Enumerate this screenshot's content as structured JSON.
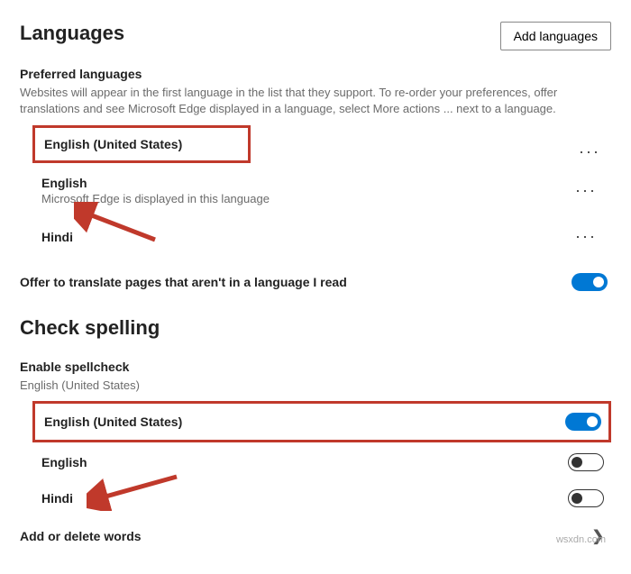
{
  "section_languages_title": "Languages",
  "add_languages_button": "Add languages",
  "preferred_heading": "Preferred languages",
  "preferred_desc": "Websites will appear in the first language in the list that they support. To re-order your preferences, offer translations and see Microsoft Edge displayed in a language, select More actions ... next to a language.",
  "langs": {
    "en_us": {
      "name": "English (United States)"
    },
    "en": {
      "name": "English",
      "sub": "Microsoft Edge is displayed in this language"
    },
    "hi": {
      "name": "Hindi"
    }
  },
  "offer_translate_label": "Offer to translate pages that aren't in a language I read",
  "section_spelling_title": "Check spelling",
  "enable_spellcheck_heading": "Enable spellcheck",
  "enable_spellcheck_sub": "English (United States)",
  "spell": {
    "en_us": "English (United States)",
    "en": "English",
    "hi": "Hindi"
  },
  "add_delete_words": "Add or delete words",
  "watermark": "wsxdn.com"
}
